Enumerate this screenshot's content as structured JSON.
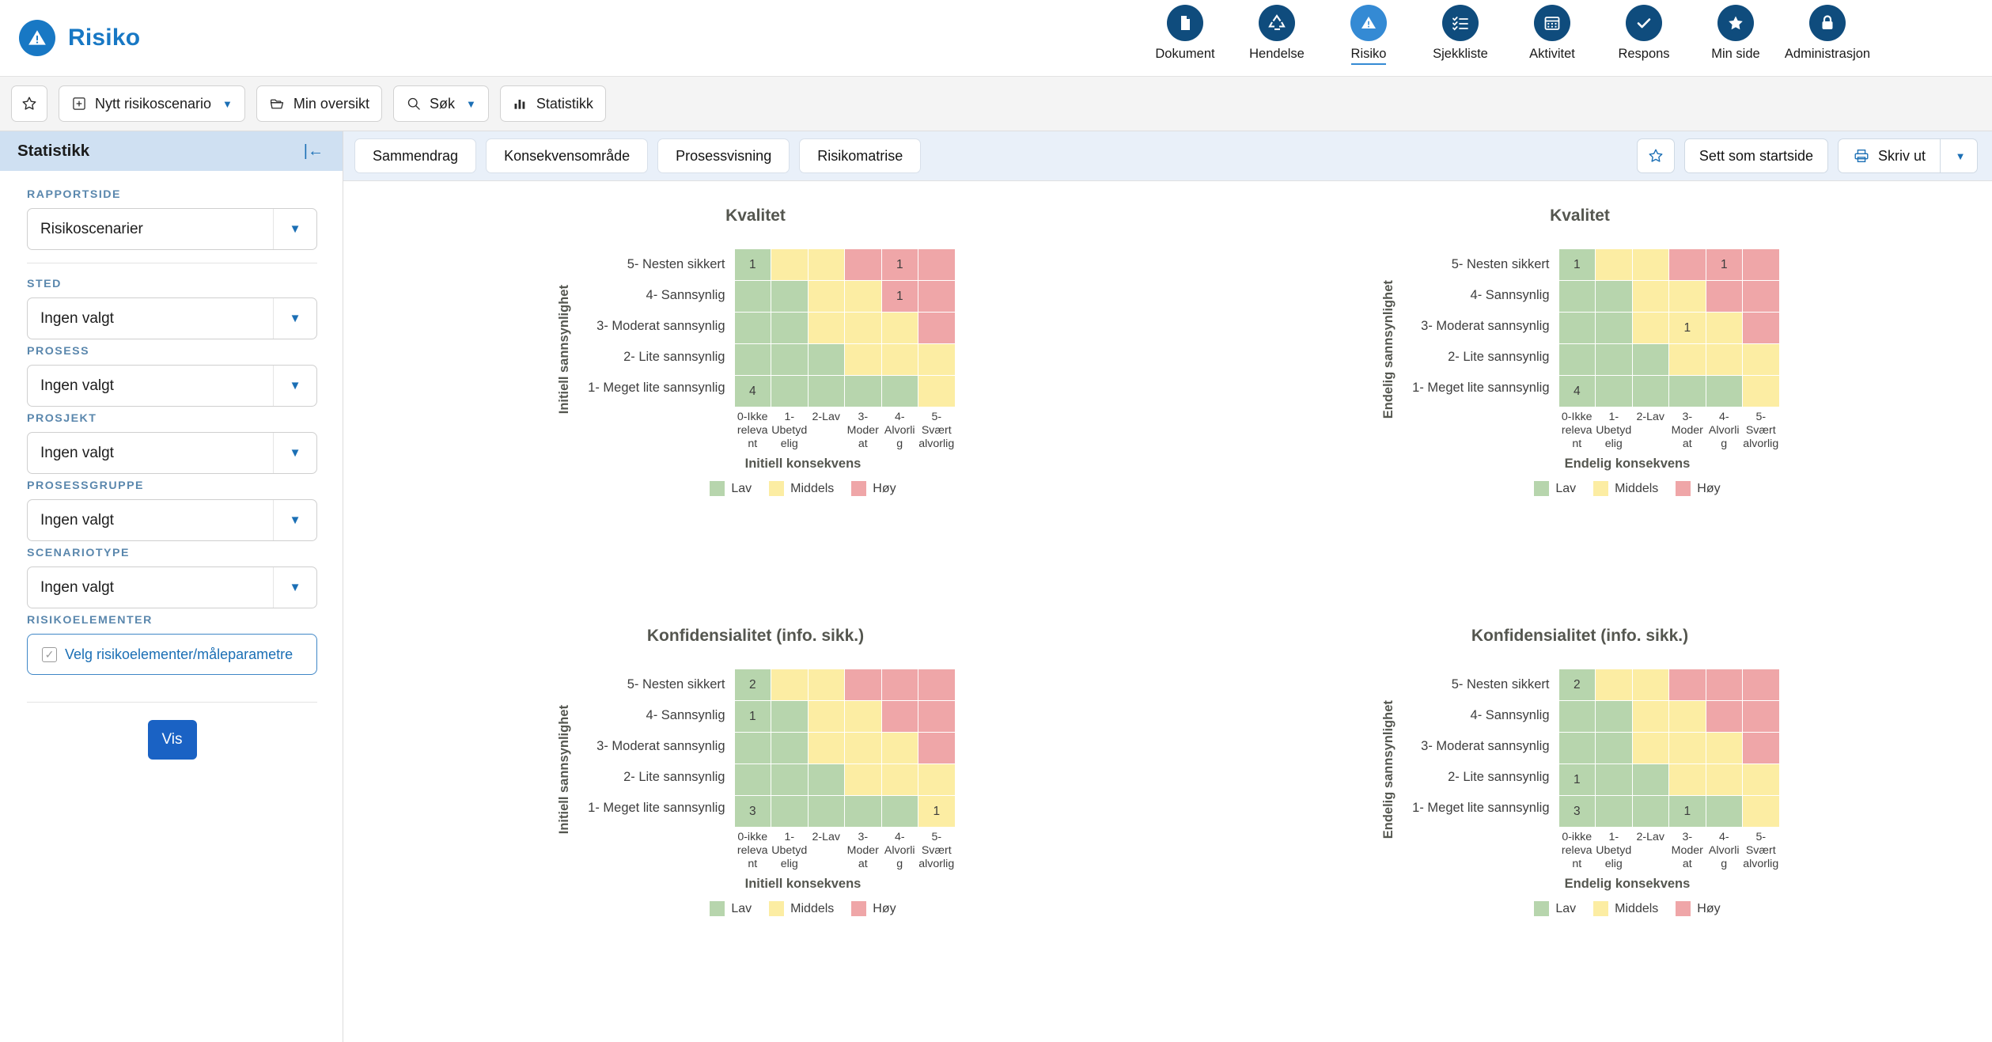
{
  "header": {
    "brand": "Risiko",
    "nav": [
      {
        "label": "Dokument",
        "icon": "document-icon",
        "active": false
      },
      {
        "label": "Hendelse",
        "icon": "recycle-icon",
        "active": false
      },
      {
        "label": "Risiko",
        "icon": "warning-triangle-icon",
        "active": true
      },
      {
        "label": "Sjekkliste",
        "icon": "checklist-icon",
        "active": false
      },
      {
        "label": "Aktivitet",
        "icon": "calendar-icon",
        "active": false
      },
      {
        "label": "Respons",
        "icon": "check-icon",
        "active": false
      },
      {
        "label": "Min side",
        "icon": "star-icon",
        "active": false
      },
      {
        "label": "Administrasjon",
        "icon": "lock-icon",
        "active": false
      }
    ]
  },
  "toolbar": {
    "favorite_label": "",
    "new_scenario": "Nytt risikoscenario",
    "my_overview": "Min oversikt",
    "search": "Søk",
    "statistics": "Statistikk"
  },
  "sidebar": {
    "title": "Statistikk",
    "fields": [
      {
        "label": "RAPPORTSIDE",
        "value": "Risikoscenarier"
      },
      {
        "label": "STED",
        "value": "Ingen valgt"
      },
      {
        "label": "PROSESS",
        "value": "Ingen valgt"
      },
      {
        "label": "PROSJEKT",
        "value": "Ingen valgt"
      },
      {
        "label": "PROSESSGRUPPE",
        "value": "Ingen valgt"
      },
      {
        "label": "SCENARIOTYPE",
        "value": "Ingen valgt"
      }
    ],
    "risk_elements_label": "RISIKOELEMENTER",
    "risk_elements_button": "Velg risikoelementer/måleparametre",
    "show_button": "Vis"
  },
  "tabs": [
    {
      "label": "Sammendrag"
    },
    {
      "label": "Konsekvensområde"
    },
    {
      "label": "Prosessvisning"
    },
    {
      "label": "Risikomatrise"
    }
  ],
  "tabbar_actions": {
    "set_as_startpage": "Sett som startside",
    "print": "Skriv ut"
  },
  "chart_data": [
    {
      "type": "heatmap",
      "title": "Kvalitet",
      "ylabel": "Initiell sannsynlighet",
      "xlabel": "Initiell konsekvens",
      "yticks": [
        "5- Nesten sikkert",
        "4- Sannsynlig",
        "3- Moderat sannsynlig",
        "2- Lite sannsynlig",
        "1- Meget lite sannsynlig"
      ],
      "xticks": [
        "0-Ikke relevant",
        "1-Ubetydelig",
        "2-Lav",
        "3-Moderat",
        "4-Alvorlig",
        "5-Svært alvorlig"
      ],
      "legend": [
        {
          "label": "Lav",
          "color": "#b7d5ad"
        },
        {
          "label": "Middels",
          "color": "#fceda3"
        },
        {
          "label": "Høy",
          "color": "#efa6a8"
        }
      ],
      "risk_levels": [
        [
          "low",
          "med",
          "med",
          "high",
          "high",
          "high"
        ],
        [
          "low",
          "low",
          "med",
          "med",
          "high",
          "high"
        ],
        [
          "low",
          "low",
          "med",
          "med",
          "med",
          "high"
        ],
        [
          "low",
          "low",
          "low",
          "med",
          "med",
          "med"
        ],
        [
          "low",
          "low",
          "low",
          "low",
          "low",
          "med"
        ]
      ],
      "counts": [
        [
          "1",
          "",
          "",
          "",
          "1",
          ""
        ],
        [
          "",
          "",
          "",
          "",
          "1",
          ""
        ],
        [
          "",
          "",
          "",
          "",
          "",
          ""
        ],
        [
          "",
          "",
          "",
          "",
          "",
          ""
        ],
        [
          "4",
          "",
          "",
          "",
          "",
          ""
        ]
      ]
    },
    {
      "type": "heatmap",
      "title": "Kvalitet",
      "ylabel": "Endelig sannsynlighet",
      "xlabel": "Endelig konsekvens",
      "yticks": [
        "5- Nesten sikkert",
        "4- Sannsynlig",
        "3- Moderat sannsynlig",
        "2- Lite sannsynlig",
        "1- Meget lite sannsynlig"
      ],
      "xticks": [
        "0-Ikke relevant",
        "1-Ubetydelig",
        "2-Lav",
        "3-Moderat",
        "4-Alvorlig",
        "5-Svært alvorlig"
      ],
      "legend": [
        {
          "label": "Lav",
          "color": "#b7d5ad"
        },
        {
          "label": "Middels",
          "color": "#fceda3"
        },
        {
          "label": "Høy",
          "color": "#efa6a8"
        }
      ],
      "risk_levels": [
        [
          "low",
          "med",
          "med",
          "high",
          "high",
          "high"
        ],
        [
          "low",
          "low",
          "med",
          "med",
          "high",
          "high"
        ],
        [
          "low",
          "low",
          "med",
          "med",
          "med",
          "high"
        ],
        [
          "low",
          "low",
          "low",
          "med",
          "med",
          "med"
        ],
        [
          "low",
          "low",
          "low",
          "low",
          "low",
          "med"
        ]
      ],
      "counts": [
        [
          "1",
          "",
          "",
          "",
          "1",
          ""
        ],
        [
          "",
          "",
          "",
          "",
          "",
          ""
        ],
        [
          "",
          "",
          "",
          "1",
          "",
          ""
        ],
        [
          "",
          "",
          "",
          "",
          "",
          ""
        ],
        [
          "4",
          "",
          "",
          "",
          "",
          ""
        ]
      ]
    },
    {
      "type": "heatmap",
      "title": "Konfidensialitet (info. sikk.)",
      "ylabel": "Initiell sannsynlighet",
      "xlabel": "Initiell konsekvens",
      "yticks": [
        "5- Nesten sikkert",
        "4- Sannsynlig",
        "3- Moderat sannsynlig",
        "2- Lite sannsynlig",
        "1- Meget lite sannsynlig"
      ],
      "xticks": [
        "0-ikke relevant",
        "1-Ubetydelig",
        "2-Lav",
        "3-Moderat",
        "4-Alvorlig",
        "5-Svært alvorlig"
      ],
      "legend": [
        {
          "label": "Lav",
          "color": "#b7d5ad"
        },
        {
          "label": "Middels",
          "color": "#fceda3"
        },
        {
          "label": "Høy",
          "color": "#efa6a8"
        }
      ],
      "risk_levels": [
        [
          "low",
          "med",
          "med",
          "high",
          "high",
          "high"
        ],
        [
          "low",
          "low",
          "med",
          "med",
          "high",
          "high"
        ],
        [
          "low",
          "low",
          "med",
          "med",
          "med",
          "high"
        ],
        [
          "low",
          "low",
          "low",
          "med",
          "med",
          "med"
        ],
        [
          "low",
          "low",
          "low",
          "low",
          "low",
          "med"
        ]
      ],
      "counts": [
        [
          "2",
          "",
          "",
          "",
          "",
          ""
        ],
        [
          "1",
          "",
          "",
          "",
          "",
          ""
        ],
        [
          "",
          "",
          "",
          "",
          "",
          ""
        ],
        [
          "",
          "",
          "",
          "",
          "",
          ""
        ],
        [
          "3",
          "",
          "",
          "",
          "",
          "1"
        ]
      ]
    },
    {
      "type": "heatmap",
      "title": "Konfidensialitet (info. sikk.)",
      "ylabel": "Endelig sannsynlighet",
      "xlabel": "Endelig konsekvens",
      "yticks": [
        "5- Nesten sikkert",
        "4- Sannsynlig",
        "3- Moderat sannsynlig",
        "2- Lite sannsynlig",
        "1- Meget lite sannsynlig"
      ],
      "xticks": [
        "0-ikke relevant",
        "1-Ubetydelig",
        "2-Lav",
        "3-Moderat",
        "4-Alvorlig",
        "5-Svært alvorlig"
      ],
      "legend": [
        {
          "label": "Lav",
          "color": "#b7d5ad"
        },
        {
          "label": "Middels",
          "color": "#fceda3"
        },
        {
          "label": "Høy",
          "color": "#efa6a8"
        }
      ],
      "risk_levels": [
        [
          "low",
          "med",
          "med",
          "high",
          "high",
          "high"
        ],
        [
          "low",
          "low",
          "med",
          "med",
          "high",
          "high"
        ],
        [
          "low",
          "low",
          "med",
          "med",
          "med",
          "high"
        ],
        [
          "low",
          "low",
          "low",
          "med",
          "med",
          "med"
        ],
        [
          "low",
          "low",
          "low",
          "low",
          "low",
          "med"
        ]
      ],
      "counts": [
        [
          "2",
          "",
          "",
          "",
          "",
          ""
        ],
        [
          "",
          "",
          "",
          "",
          "",
          ""
        ],
        [
          "",
          "",
          "",
          "",
          "",
          ""
        ],
        [
          "1",
          "",
          "",
          "",
          "",
          ""
        ],
        [
          "3",
          "",
          "",
          "1",
          "",
          ""
        ]
      ]
    }
  ]
}
